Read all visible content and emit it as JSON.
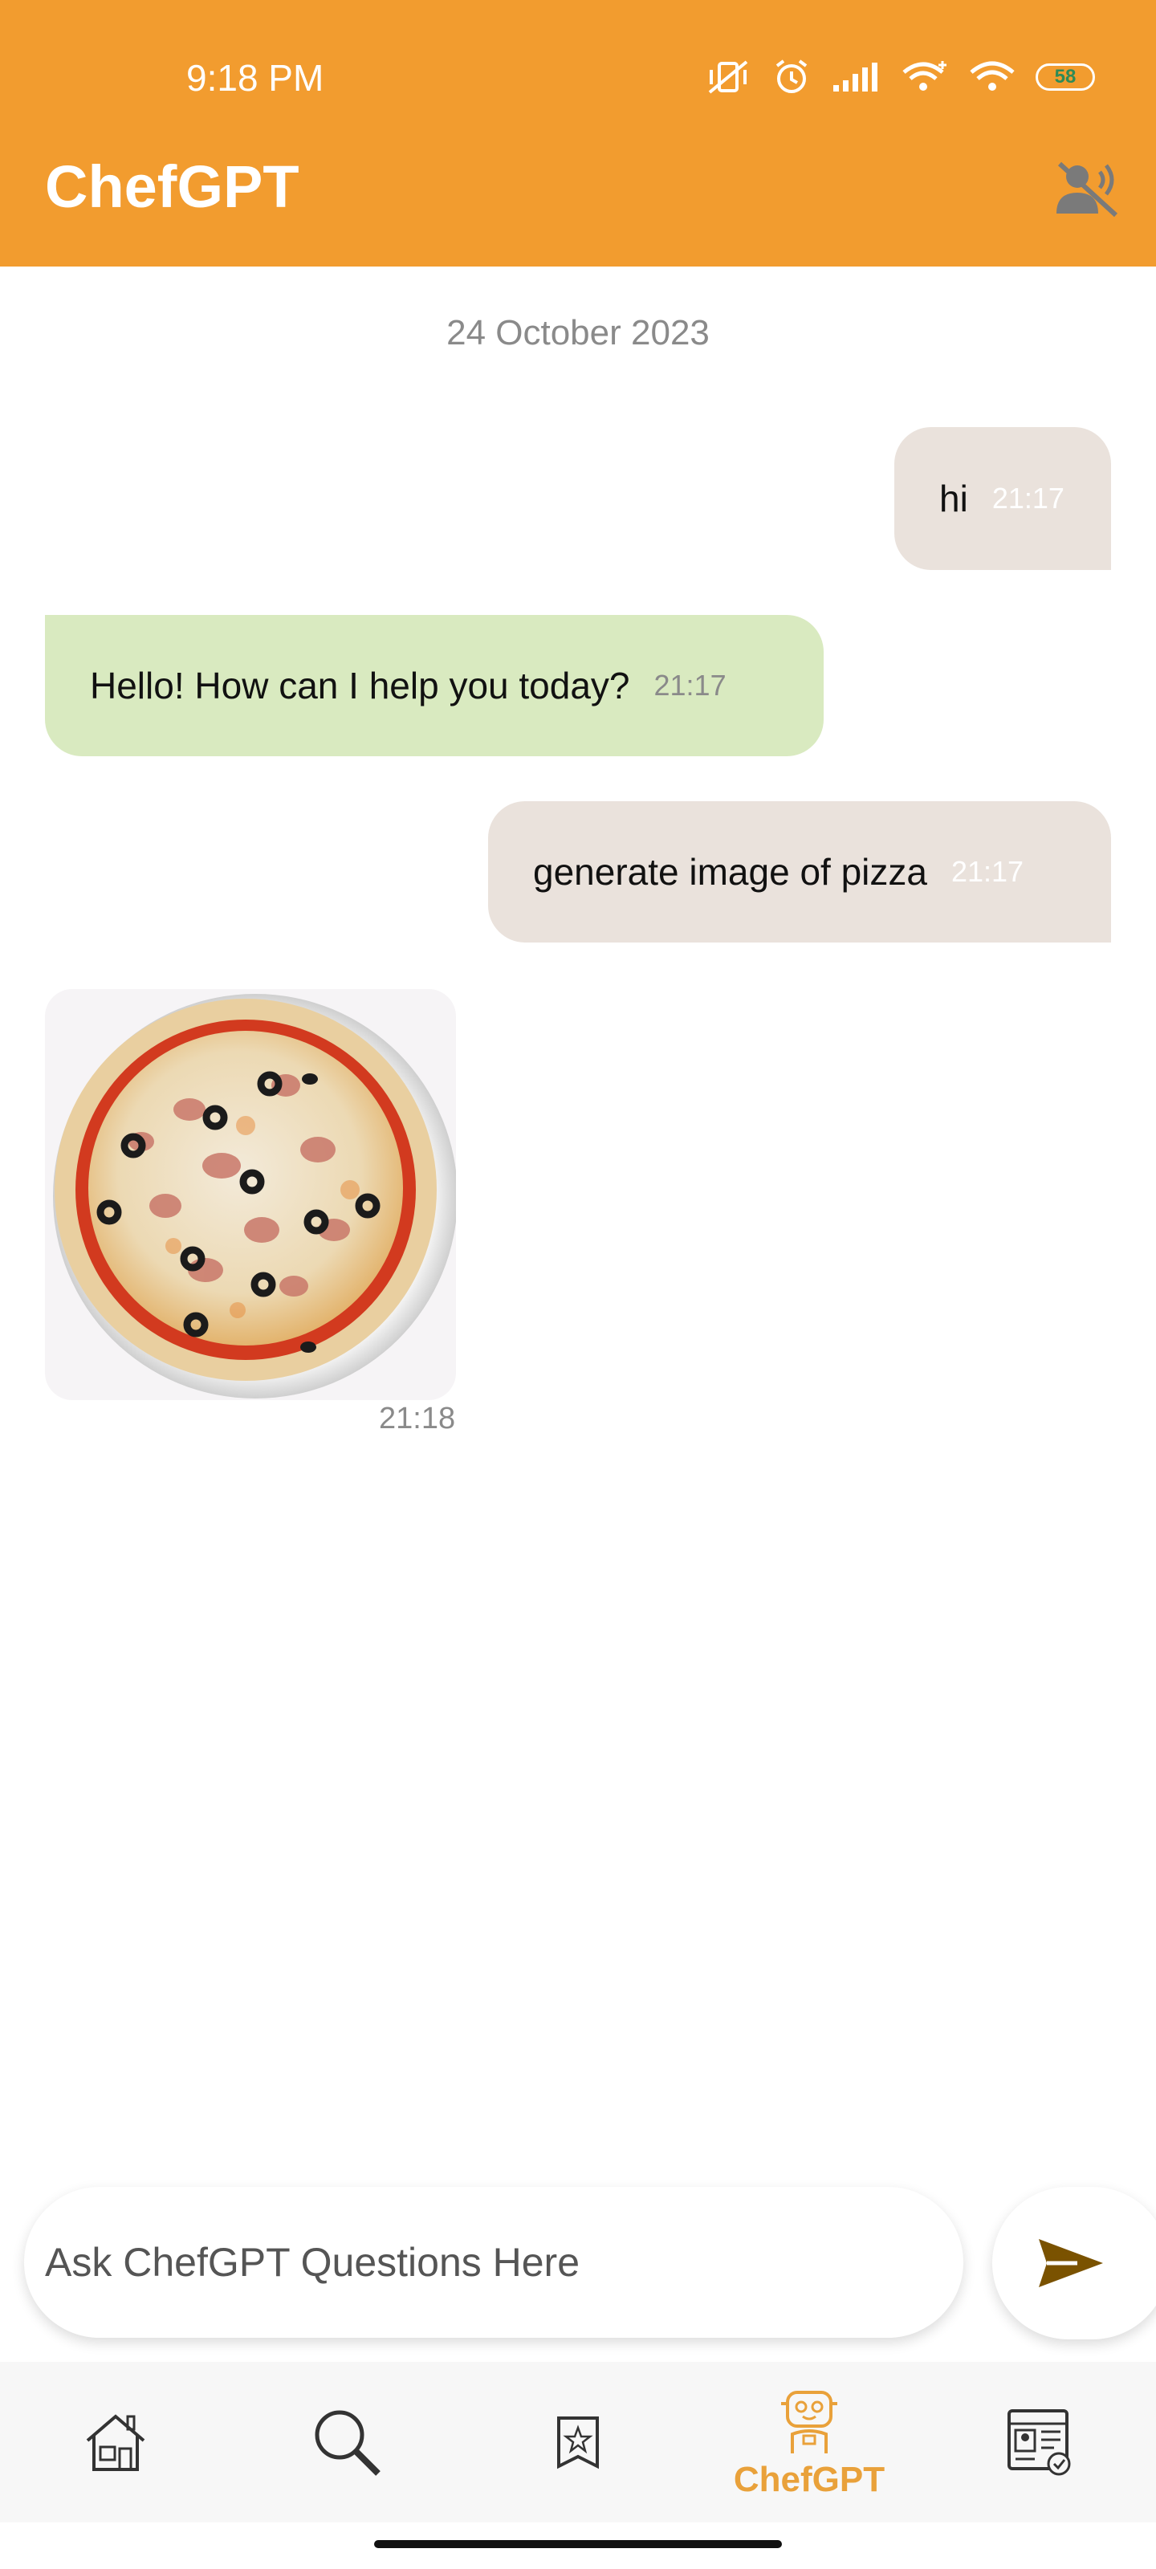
{
  "status_bar": {
    "time": "9:18 PM",
    "battery": "58"
  },
  "header": {
    "title": "ChefGPT"
  },
  "chat": {
    "date": "24 October 2023",
    "messages": [
      {
        "sender": "user",
        "text": "hi",
        "time": "21:17"
      },
      {
        "sender": "bot",
        "text": "Hello! How can I help you today?",
        "time": "21:17"
      },
      {
        "sender": "user",
        "text": "generate image of pizza",
        "time": "21:17"
      },
      {
        "sender": "bot",
        "type": "image",
        "time": "21:18"
      }
    ]
  },
  "input": {
    "placeholder": "Ask ChefGPT Questions Here"
  },
  "nav": {
    "items": [
      "home",
      "search",
      "saved",
      "ChefGPT",
      "profile"
    ],
    "active_label": "ChefGPT"
  },
  "colors": {
    "accent": "#F29C2F",
    "user_bubble": "#EAE2DC",
    "bot_bubble": "#D9EAC0",
    "send": "#7A5200"
  }
}
